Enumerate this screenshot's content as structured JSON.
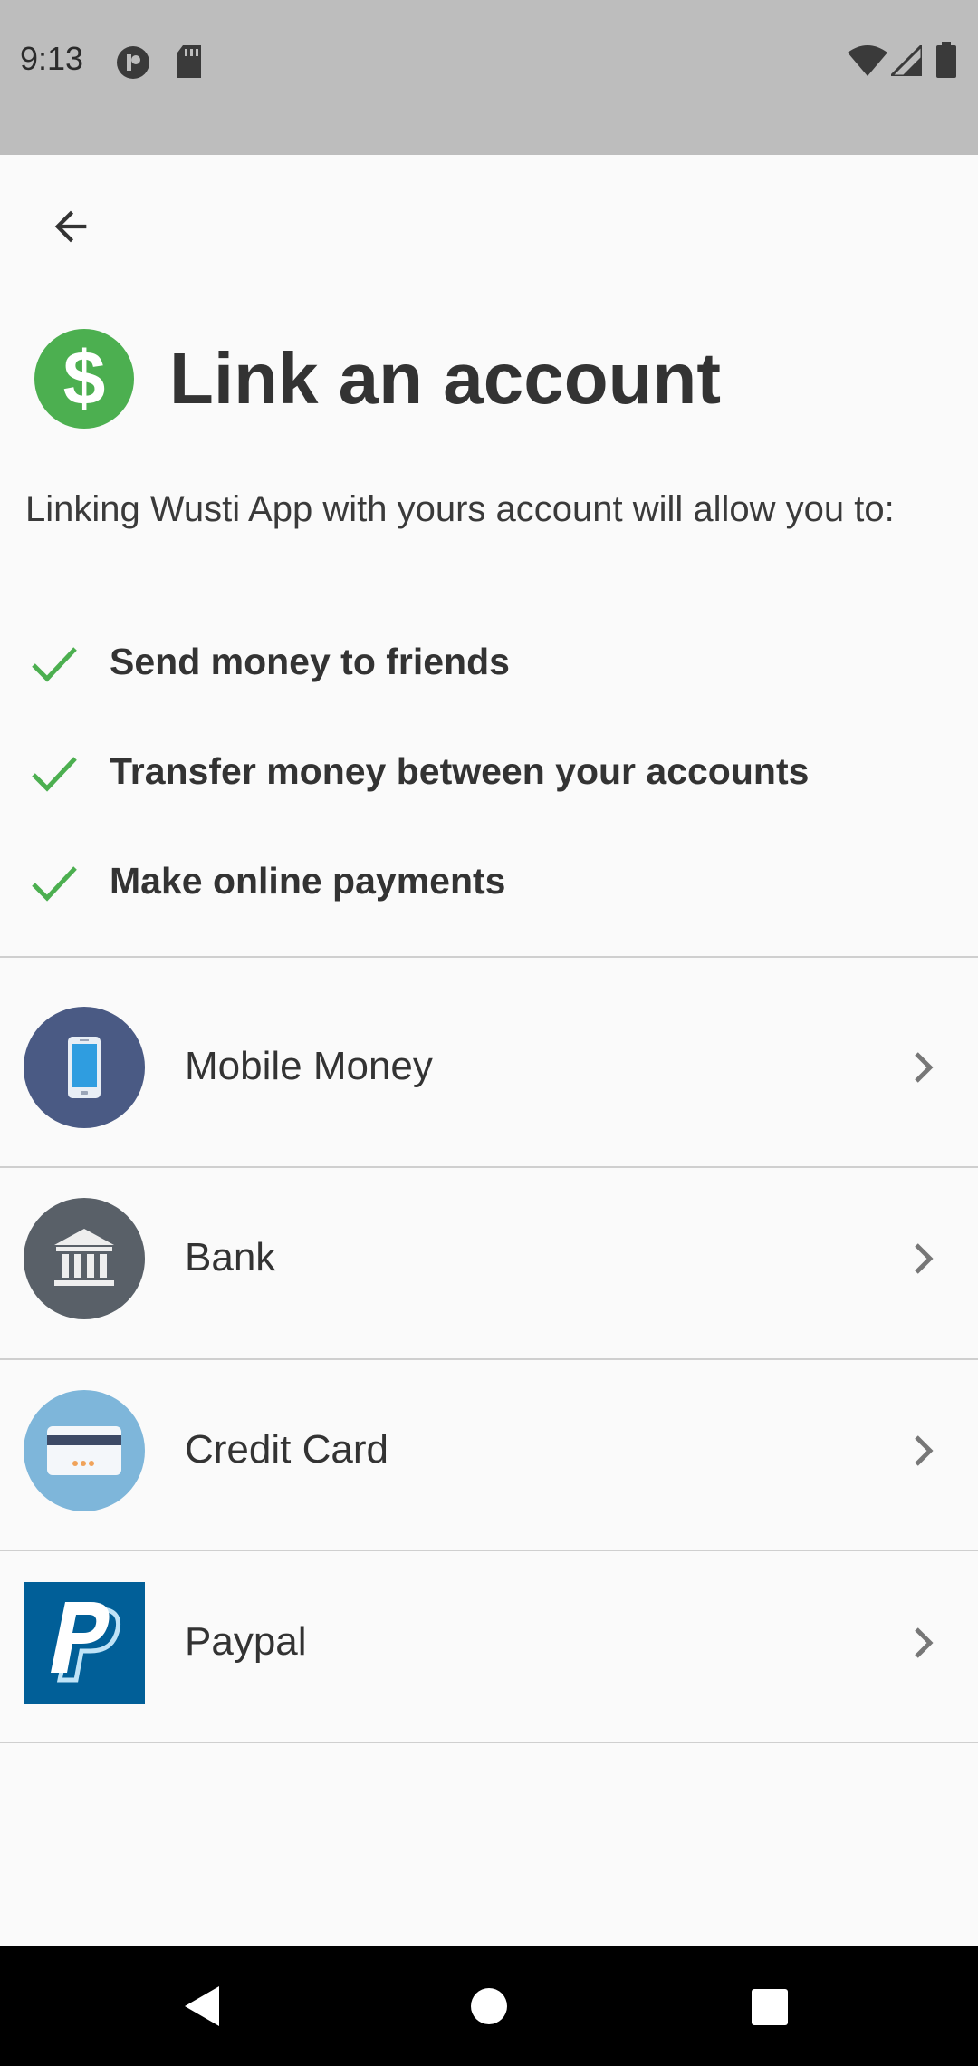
{
  "status_bar": {
    "time": "9:13"
  },
  "header": {
    "title": "Link an account",
    "intro": "Linking Wusti App with yours  account will allow you to:"
  },
  "benefits": [
    {
      "label": "Send money to friends"
    },
    {
      "label": "Transfer money between your accounts"
    },
    {
      "label": "Make online payments"
    }
  ],
  "options": [
    {
      "label": "Mobile Money",
      "icon": "mobile-phone-icon"
    },
    {
      "label": "Bank",
      "icon": "bank-icon"
    },
    {
      "label": "Credit Card",
      "icon": "credit-card-icon"
    },
    {
      "label": "Paypal",
      "icon": "paypal-logo-icon"
    }
  ],
  "colors": {
    "accent_green": "#4caf50",
    "mobile_bg": "#4a5a84",
    "bank_bg": "#596068",
    "card_bg": "#7eb6da",
    "paypal_bg": "#015f98"
  }
}
